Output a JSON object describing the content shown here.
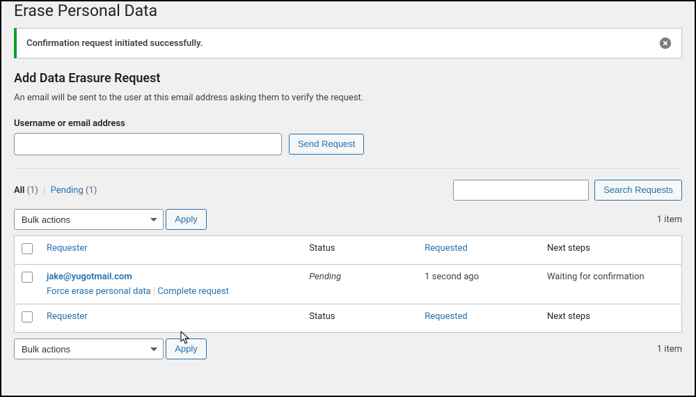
{
  "page_title": "Erase Personal Data",
  "notice": {
    "message": "Confirmation request initiated successfully."
  },
  "add_section": {
    "heading": "Add Data Erasure Request",
    "description": "An email will be sent to the user at this email address asking them to verify the request.",
    "field_label": "Username or email address",
    "button": "Send Request"
  },
  "views": {
    "all_label": "All",
    "all_count": "(1)",
    "pending_label": "Pending",
    "pending_count": "(1)"
  },
  "search": {
    "button": "Search Requests"
  },
  "bulk": {
    "placeholder": "Bulk actions",
    "apply": "Apply"
  },
  "count_label": "1 item",
  "columns": {
    "requester": "Requester",
    "status": "Status",
    "requested": "Requested",
    "next": "Next steps"
  },
  "rows": [
    {
      "email": "jake@yugotmail.com",
      "action_force": "Force erase personal data",
      "action_complete": "Complete request",
      "status": "Pending",
      "requested": "1 second ago",
      "next": "Waiting for confirmation"
    }
  ]
}
